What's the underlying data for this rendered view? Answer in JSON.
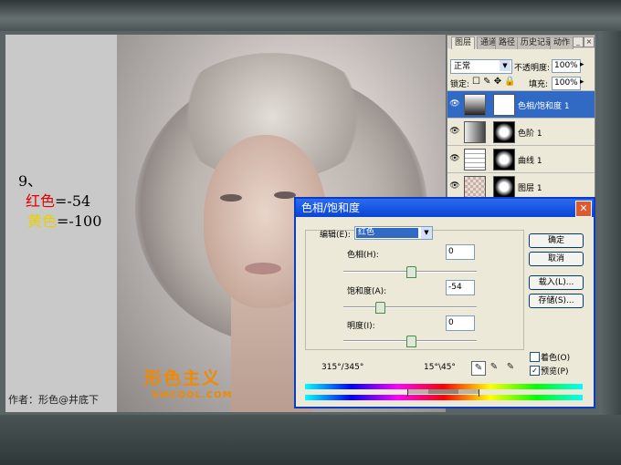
{
  "tutorial": {
    "step": "9、",
    "red_label": "红色",
    "red_value": "=-54",
    "yellow_label": "黄色",
    "yellow_value": "=-100",
    "author": "作者：形色@井底下"
  },
  "watermark": {
    "logo": "形色主义",
    "site": "SWCOOL.COM"
  },
  "layers_panel": {
    "tabs": [
      "图层",
      "通道",
      "路径",
      "历史记录",
      "动作"
    ],
    "blend_mode": "正常",
    "opacity_label": "不透明度:",
    "opacity": "100%",
    "lock_label": "锁定:",
    "fill_label": "填充:",
    "fill": "100%",
    "layers": [
      {
        "name": "色相/饱和度 1",
        "selected": true
      },
      {
        "name": "色阶 1",
        "selected": false
      },
      {
        "name": "曲线 1",
        "selected": false
      },
      {
        "name": "图层 1",
        "selected": false
      }
    ]
  },
  "hue_sat_dialog": {
    "title": "色相/饱和度",
    "edit_label": "编辑(E):",
    "edit_value": "红色",
    "hue_label": "色相(H):",
    "hue_value": "0",
    "saturation_label": "饱和度(A):",
    "saturation_value": "-54",
    "lightness_label": "明度(I):",
    "lightness_value": "0",
    "buttons": {
      "ok": "确定",
      "cancel": "取消",
      "load": "载入(L)...",
      "save": "存储(S)..."
    },
    "range_left": "315°/345°",
    "range_right": "15°\\45°",
    "colorize_label": "着色(O)",
    "colorize_checked": false,
    "preview_label": "预览(P)",
    "preview_checked": true
  },
  "colors": {
    "red_label": "#e00000",
    "yellow_label": "#e8d000",
    "title_bar": "#0a44d4",
    "selection": "#316ac5"
  }
}
